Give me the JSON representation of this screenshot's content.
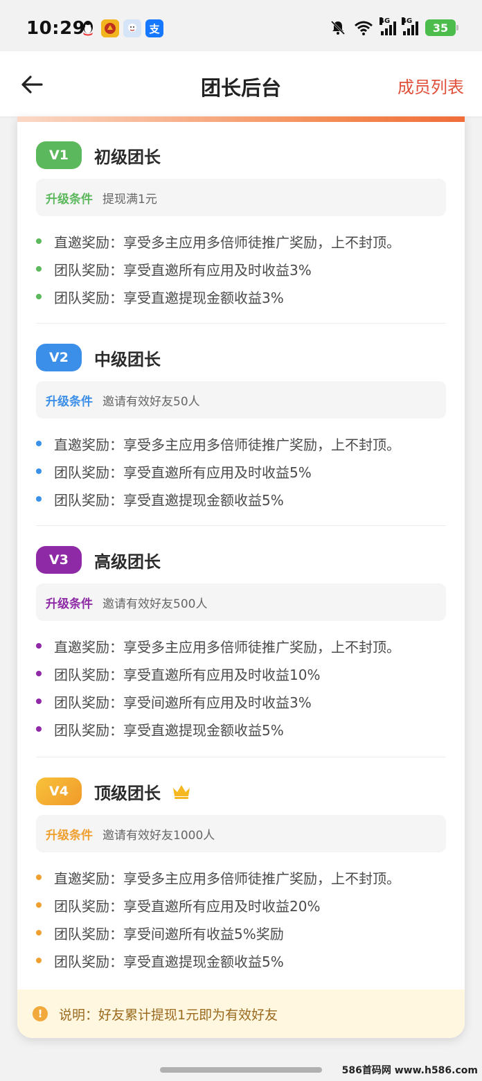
{
  "status_bar": {
    "time": "10:29",
    "battery": "35",
    "apps": [
      "qq-icon",
      "app-icon-2",
      "app-icon-3",
      "alipay-icon"
    ],
    "alipay_label": "支",
    "network_a": "4G",
    "network_b": "4G"
  },
  "header": {
    "title": "团长后台",
    "action": "成员列表"
  },
  "colors": {
    "v1": "#5cb85c",
    "v2": "#3b8fe8",
    "v3": "#8e2aa6",
    "v4": "#f0a030",
    "accent": "#e0503a"
  },
  "levels": [
    {
      "badge": "V1",
      "name": "初级团长",
      "condition_label": "升级条件",
      "condition": "提现满1元",
      "perks": [
        "直邀奖励：享受多主应用多倍师徒推广奖励，上不封顶。",
        "团队奖励：享受直邀所有应用及时收益3%",
        "团队奖励：享受直邀提现金额收益3%"
      ]
    },
    {
      "badge": "V2",
      "name": "中级团长",
      "condition_label": "升级条件",
      "condition": "邀请有效好友50人",
      "perks": [
        "直邀奖励：享受多主应用多倍师徒推广奖励，上不封顶。",
        "团队奖励：享受直邀所有应用及时收益5%",
        "团队奖励：享受直邀提现金额收益5%"
      ]
    },
    {
      "badge": "V3",
      "name": "高级团长",
      "condition_label": "升级条件",
      "condition": "邀请有效好友500人",
      "perks": [
        "直邀奖励：享受多主应用多倍师徒推广奖励，上不封顶。",
        "团队奖励：享受直邀所有应用及时收益10%",
        "团队奖励：享受间邀所有应用及时收益3%",
        "团队奖励：享受直邀提现金额收益5%"
      ]
    },
    {
      "badge": "V4",
      "name": "顶级团长",
      "condition_label": "升级条件",
      "condition": "邀请有效好友1000人",
      "perks": [
        "直邀奖励：享受多主应用多倍师徒推广奖励，上不封顶。",
        "团队奖励：享受直邀所有应用及时收益20%",
        "团队奖励：享受间邀所有收益5%奖励",
        "团队奖励：享受直邀提现金额收益5%"
      ]
    }
  ],
  "note": {
    "icon": "!",
    "text": "说明：好友累计提现1元即为有效好友"
  },
  "watermark": "586首码网 www.h586.com"
}
